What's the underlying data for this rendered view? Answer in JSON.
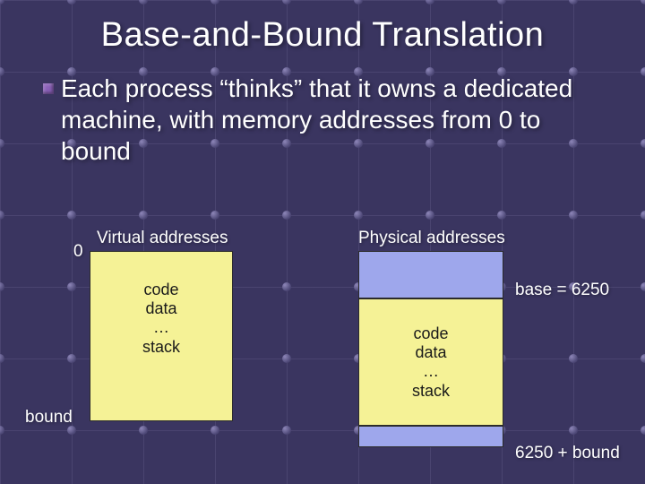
{
  "title": "Base-and-Bound Translation",
  "bullet": "Each process “thinks” that it owns a dedicated machine, with memory addresses from 0 to bound",
  "virtual": {
    "heading": "Virtual addresses",
    "top_label": "0",
    "box_lines": [
      "code",
      "data",
      "…",
      "stack"
    ],
    "bottom_label": "bound"
  },
  "physical": {
    "heading": "Physical addresses",
    "base_label": "base = 6250",
    "box_lines": [
      "code",
      "data",
      "…",
      "stack"
    ],
    "end_label": "6250 + bound"
  }
}
